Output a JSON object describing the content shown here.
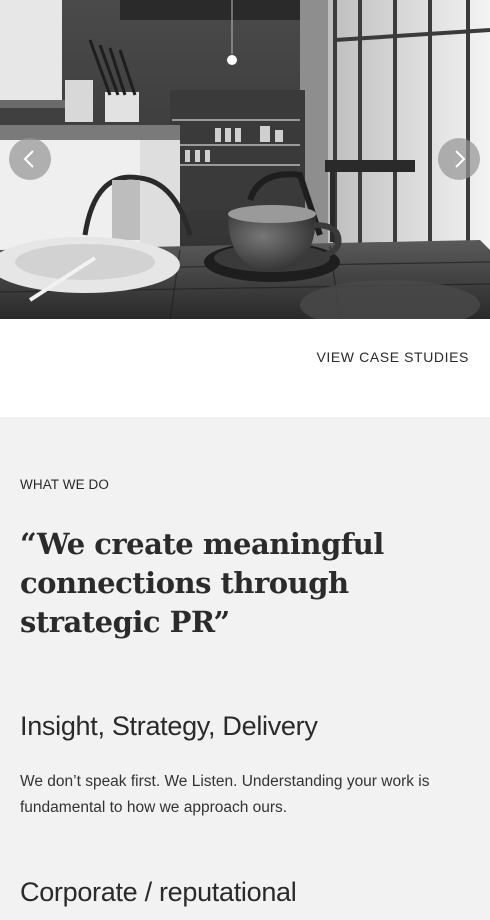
{
  "hero": {
    "image_icon": "coffee-cup-photo",
    "prev_icon": "chevron-left-icon",
    "next_icon": "chevron-right-icon"
  },
  "cta": {
    "label": "VIEW CASE STUDIES"
  },
  "what_we_do": {
    "label": "WHAT WE DO",
    "quote": "“We create meaningful connections through strategic PR”",
    "services": [
      {
        "title": "Insight, Strategy, Delivery",
        "description": "We don’t speak first. We Listen. Understanding your work is fundamental to how we approach ours."
      },
      {
        "title": "Corporate / reputational"
      }
    ]
  },
  "colors": {
    "section_background": "#f2f2f2",
    "text": "#2b2b2b",
    "carousel_button": "#969696"
  }
}
